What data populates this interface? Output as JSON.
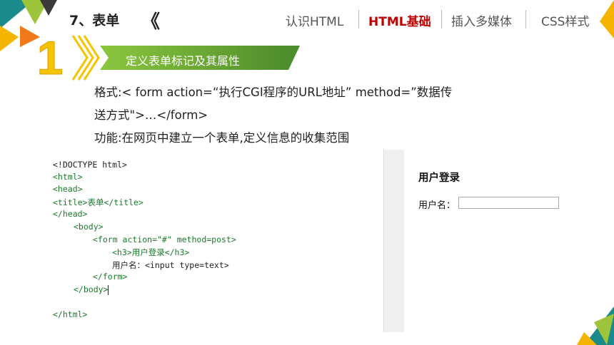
{
  "header": {
    "chapter_title": "7、表单",
    "chevron": "《",
    "nav": [
      "认识HTML",
      "HTML基础",
      "插入多媒体",
      "CSS样式"
    ],
    "active_nav_index": 1
  },
  "section": {
    "number": "1",
    "title": "定义表单标记及其属性"
  },
  "body": {
    "syntax_line1": "格式:< form action=“执行CGI程序的URL地址” method=”数据传",
    "syntax_line2": "送方式\">…</form>",
    "function_line": "功能:在网页中建立一个表单,定义信息的收集范围"
  },
  "code": {
    "lines": [
      "<!DOCTYPE html>",
      "<html>",
      "<head>",
      "<title>表单</title>",
      "</head>",
      "<body>",
      "<form action=\"#\" method=post>",
      "<h3>用户登录</h3>",
      "用户名：<input type=text>",
      "</form>",
      "</body>",
      "</html>"
    ]
  },
  "preview": {
    "heading": "用户登录",
    "field_label": "用户名：",
    "field_value": ""
  },
  "colors": {
    "accent_red": "#c00000",
    "ribbon_green": "#5a9a2a",
    "tag_green": "#1a7a2a",
    "string_red": "#c0392b",
    "yellow": "#f5c400",
    "teal": "#1a8a8a"
  }
}
